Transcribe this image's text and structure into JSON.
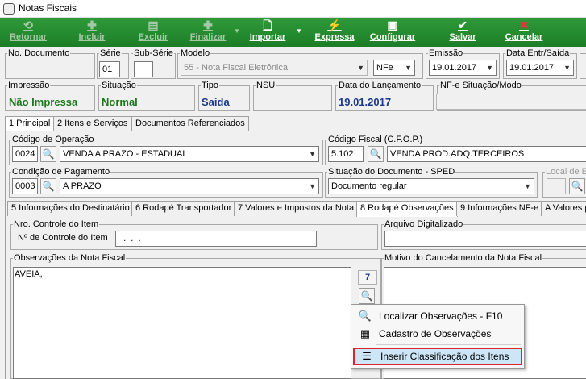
{
  "window": {
    "title": "Notas Fiscais"
  },
  "toolbar": [
    {
      "label": "Retornar",
      "icon": "return-icon",
      "enabled": false
    },
    {
      "label": "Incluir",
      "icon": "plus-icon",
      "enabled": false
    },
    {
      "label": "Excluir",
      "icon": "trash-icon",
      "enabled": false
    },
    {
      "label": "Finalizar",
      "icon": "finalize-icon",
      "enabled": false
    },
    {
      "label": "Importar",
      "icon": "import-icon",
      "enabled": true
    },
    {
      "label": "Expressa",
      "icon": "express-icon",
      "enabled": true
    },
    {
      "label": "Configurar",
      "icon": "configure-icon",
      "enabled": true
    },
    {
      "label": "Salvar",
      "icon": "check-icon",
      "enabled": true
    },
    {
      "label": "Cancelar",
      "icon": "cancel-x-icon",
      "enabled": true
    }
  ],
  "header": {
    "no_documento_label": "No. Documento",
    "no_documento_value": "",
    "serie_label": "Série",
    "serie_value": "01",
    "subserie_label": "Sub-Série",
    "subserie_value": "",
    "modelo_label": "Modelo",
    "modelo_value": "55 - Nota Fiscal Eletrônica",
    "modelo_tipo": "NFe",
    "emissao_label": "Emissão",
    "emissao_value": "19.01.2017",
    "data_entr_label": "Data Entr/Saída",
    "data_entr_value": "19.01.2017"
  },
  "status": {
    "impressao_label": "Impressão",
    "impressao_value": "Não Impressa",
    "situacao_label": "Situação",
    "situacao_value": "Normal",
    "tipo_label": "Tipo",
    "tipo_value": "Saida",
    "nsu_label": "NSU",
    "data_lanc_label": "Data do Lançamento",
    "data_lanc_value": "19.01.2017",
    "nfe_situacao_label": "NF-e Situação/Modo"
  },
  "main_tabs": [
    {
      "label": "1 Principal",
      "active": true
    },
    {
      "label": "2 Itens e Serviços",
      "active": false
    },
    {
      "label": "Documentos Referenciados",
      "active": false
    }
  ],
  "principal": {
    "cod_operacao_label": "Código de Operação",
    "cod_operacao_code": "0024",
    "cod_operacao_desc": "VENDA A PRAZO - ESTADUAL",
    "cfop_label": "Código Fiscal (C.F.O.P.)",
    "cfop_code": "5.102",
    "cfop_desc": "VENDA PROD.ADQ.TERCEIROS",
    "cond_pag_label": "Condição de Pagamento",
    "cond_pag_code": "0003",
    "cond_pag_desc": "A PRAZO",
    "sit_doc_label": "Situação do Documento - SPED",
    "sit_doc_value": "Documento regular",
    "local_label": "Local de E"
  },
  "sub_tabs": [
    {
      "label": "5 Informações do Destinatário",
      "active": false
    },
    {
      "label": "6 Rodapé Transportador",
      "active": false
    },
    {
      "label": "7 Valores e Impostos da Nota",
      "active": false
    },
    {
      "label": "8 Rodapé Observações",
      "active": true
    },
    {
      "label": "9 Informações NF-e",
      "active": false
    },
    {
      "label": "A Valores p",
      "active": false
    }
  ],
  "rodape": {
    "nro_controle_group": "Nro. Controle do Item",
    "nro_controle_label": "Nº de Controle do Item",
    "nro_controle_value": "  .  .  .",
    "arquivo_label": "Arquivo Digitalizado",
    "obs_label": "Observações da Nota Fiscal",
    "obs_value": "AVEIA,",
    "obs_count": "7",
    "motivo_label": "Motivo do Cancelamento da Nota Fiscal"
  },
  "context_menu": [
    {
      "label": "Localizar Observações  - F10",
      "icon": "magnifier-icon",
      "highlighted": false
    },
    {
      "label": "Cadastro de Observações",
      "icon": "register-icon",
      "highlighted": false
    },
    {
      "label": "Inserir Classificação dos Itens",
      "icon": "insert-list-icon",
      "highlighted": true
    }
  ]
}
